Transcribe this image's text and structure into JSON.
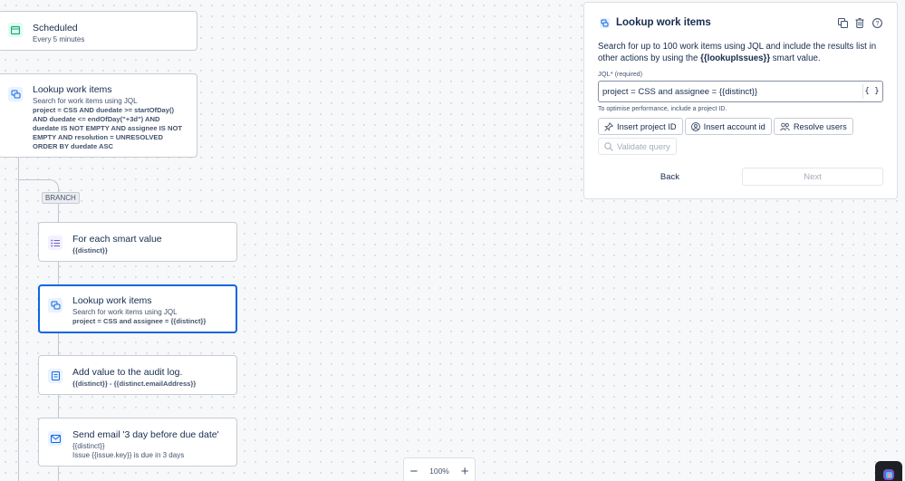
{
  "flow": {
    "trigger": {
      "title": "Scheduled",
      "subtitle": "Every 5 minutes"
    },
    "lookup1": {
      "title": "Lookup work items",
      "subtitle": "Search for work items using JQL",
      "query": "project = CSS AND duedate >= startOfDay() AND duedate <= endOfDay(\"+3d\") AND duedate IS NOT EMPTY AND assignee IS NOT EMPTY AND resolution = UNRESOLVED ORDER BY duedate ASC"
    },
    "branch_label": "BRANCH",
    "foreach": {
      "title": "For each smart value",
      "detail": "{{distinct}}"
    },
    "lookup2": {
      "title": "Lookup work items",
      "subtitle": "Search for work items using JQL",
      "query": "project = CSS and assignee = {{distinct}}"
    },
    "audit": {
      "title": "Add value to the audit log.",
      "detail": "{{distinct}} - {{distinct.emailAddress}}"
    },
    "email": {
      "title": "Send email '3 day before due date'",
      "line1": "{{distinct}}",
      "line2": "Issue {{issue.key}} is due in 3 days"
    }
  },
  "zoom": {
    "level": "100%"
  },
  "panel": {
    "title": "Lookup work items",
    "desc_before": "Search for up to 100 work items using JQL and include the results list in other actions by using the ",
    "desc_smart": "{{lookupIssues}}",
    "desc_after": " smart value.",
    "jql_label": "JQL",
    "jql_required_mark": "*",
    "jql_required_text": "(required)",
    "jql_value": "project = CSS and assignee = {{distinct}}",
    "jql_toggle": "{ }",
    "hint": "To optimise performance, include a project ID.",
    "buttons": {
      "insert_project": "Insert project ID",
      "insert_account": "Insert account id",
      "resolve_users": "Resolve users",
      "validate": "Validate query"
    },
    "back": "Back",
    "next": "Next"
  },
  "colors": {
    "accent": "#0c66e4",
    "trigger_icon": "#22a06b",
    "action_icon": "#0c66e4"
  }
}
